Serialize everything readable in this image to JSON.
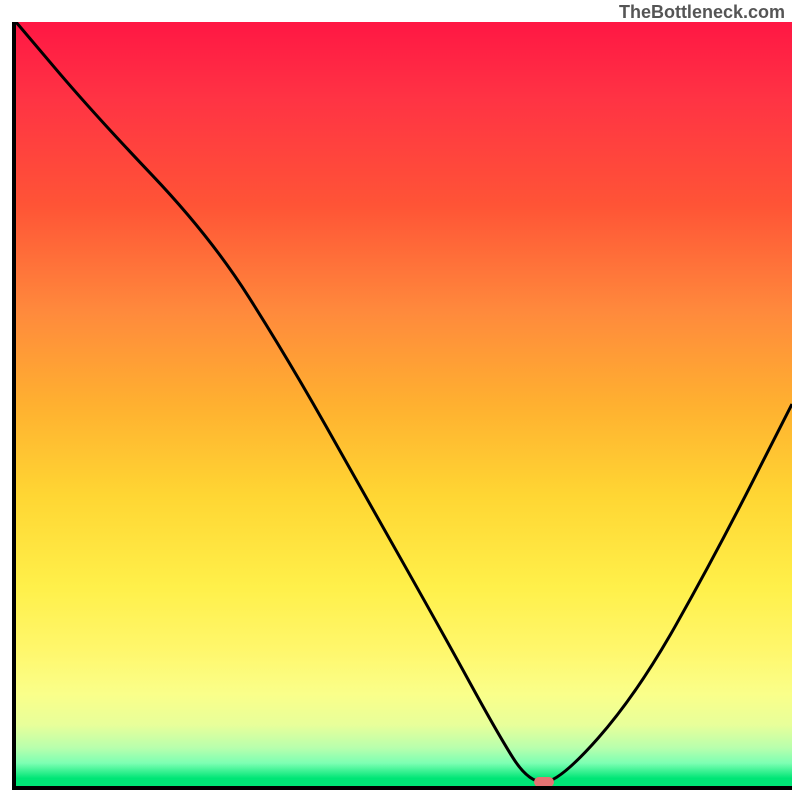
{
  "watermark": "TheBottleneck.com",
  "chart_data": {
    "type": "line",
    "title": "",
    "xlabel": "",
    "ylabel": "",
    "xlim": [
      0,
      100
    ],
    "ylim": [
      0,
      100
    ],
    "x": [
      0,
      10,
      25,
      35,
      45,
      55,
      62,
      66,
      70,
      80,
      90,
      100
    ],
    "y": [
      100,
      88,
      72,
      56,
      38,
      20,
      7,
      0.5,
      0.5,
      12,
      30,
      50
    ],
    "marker": {
      "x": 68,
      "y": 0.5
    },
    "colors": {
      "gradient_top": "#ff1744",
      "gradient_mid": "#ffd633",
      "gradient_bottom": "#00e676",
      "line": "#000000",
      "marker": "#e57373"
    }
  }
}
